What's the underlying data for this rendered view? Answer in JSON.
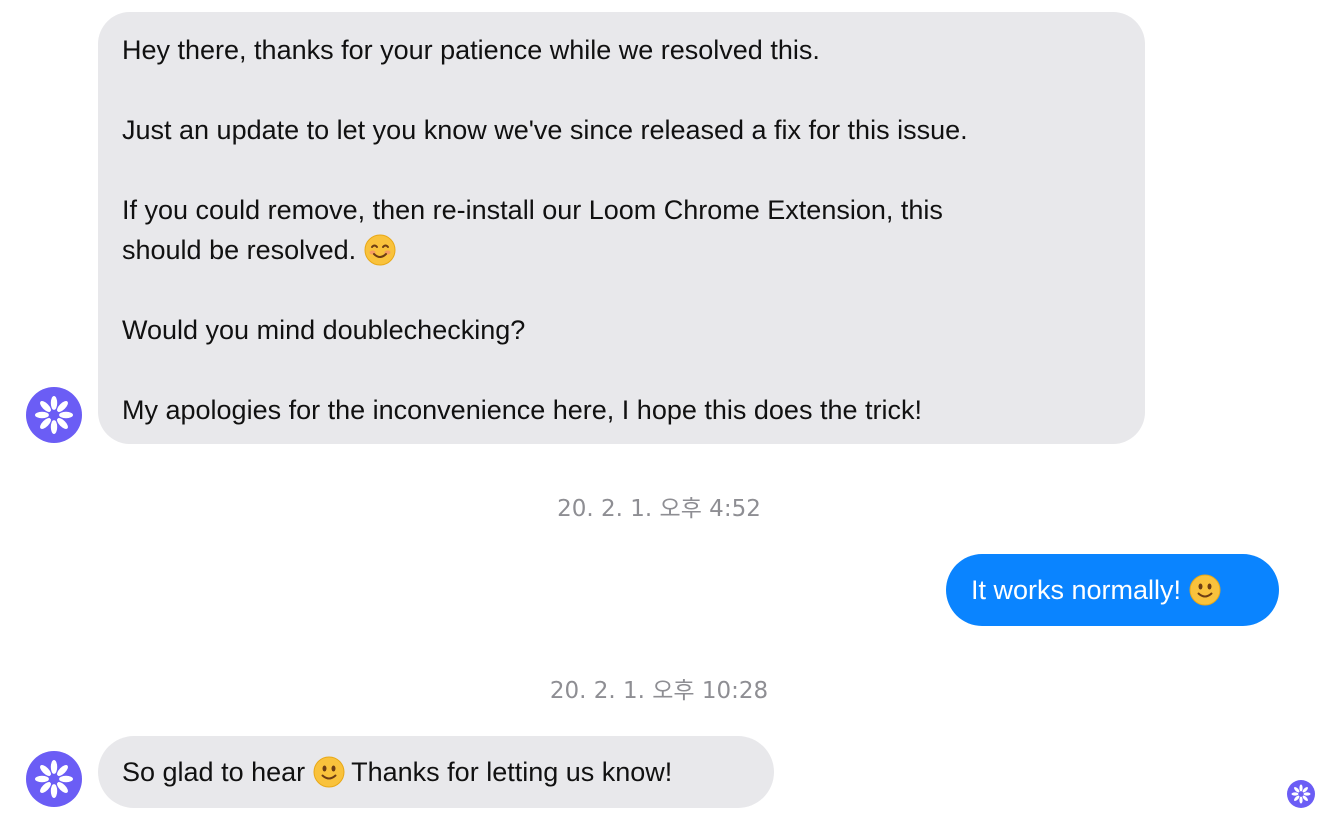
{
  "messages": {
    "support_update": {
      "line1": "Hey there, thanks for your patience while we resolved this.",
      "line2": "Just an update to let you know we've since released a fix for this issue.",
      "line3a": "If you could remove, then re-install our Loom Chrome Extension, this",
      "line3b": "should be resolved.",
      "line4": "Would you mind doublechecking?",
      "line5": "My apologies for the inconvenience here, I hope this does the trick!"
    },
    "timestamp_1": "20. 2. 1. 오후 4:52",
    "user_reply": "It works normally!",
    "timestamp_2": "20. 2. 1. 오후 10:28",
    "support_reply": {
      "part1": "So glad to hear",
      "part2": "Thanks for letting us know!"
    }
  },
  "icons": {
    "avatar": "loom-logo-icon",
    "emoji_blush": "smiling-face-with-smiling-eyes-emoji",
    "emoji_smile": "slightly-smiling-face-emoji"
  },
  "colors": {
    "incoming_bubble": "#e8e8eb",
    "outgoing_bubble": "#0a84ff",
    "avatar": "#6b5df5",
    "timestamp": "#8e8e93"
  }
}
